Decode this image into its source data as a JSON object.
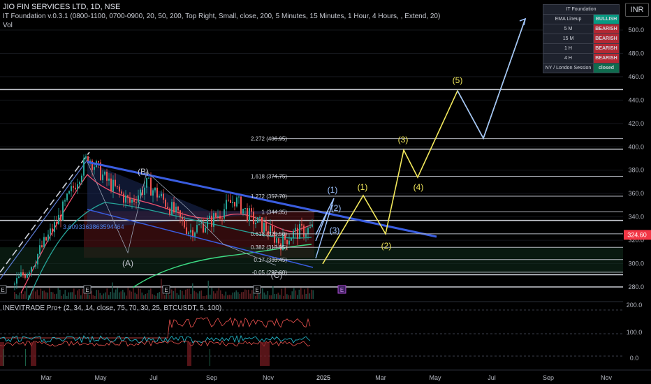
{
  "header": {
    "title": "JIO FIN SERVICES LTD, 1D, NSE",
    "indicator": "IT Foundation v.0.3.1 (0800-1100, 0700-0900, 20, 50, 200, Top Right, Small, close, 200, 5 Minutes, 15 Minutes, 1 Hour, 4 Hours, , Extend, 20)",
    "volume": "Vol",
    "currency": "INR"
  },
  "table": {
    "title": "IT Foundation",
    "rows": [
      {
        "label": "EMA Lineup",
        "value": "BULLISH",
        "color": "#089981"
      },
      {
        "label": "5 M",
        "value": "BEARISH",
        "color": "#b22833"
      },
      {
        "label": "15 M",
        "value": "BEARISH",
        "color": "#b22833"
      },
      {
        "label": "1 H",
        "value": "BEARISH",
        "color": "#b22833"
      },
      {
        "label": "4 H",
        "value": "BEARISH",
        "color": "#b22833"
      },
      {
        "label": "NY / London Session",
        "value": "closed",
        "color": "#0f6b4e"
      }
    ]
  },
  "oscillator": {
    "label": "INEVITRADE Pro+ (2, 34, 14, close, 75, 70, 30, 25, BTCUSDT, 5, 100)",
    "ticks": [
      "200.0",
      "100.0",
      "0.0"
    ]
  },
  "chart_data": {
    "type": "candlestick",
    "price_axis": {
      "min": 270,
      "max": 510,
      "ticks": [
        280,
        300,
        320,
        340,
        360,
        380,
        400,
        420,
        440,
        460,
        480,
        500
      ]
    },
    "time_axis": {
      "labels": [
        "Mar",
        "May",
        "Jul",
        "Sep",
        "Nov",
        "2025",
        "Mar",
        "May",
        "Jul",
        "Sep",
        "Nov"
      ]
    },
    "last_price": {
      "value": 324.6,
      "label": "324.60",
      "color": "#f23645"
    },
    "horizontal_levels": [
      449,
      398,
      337,
      290.5,
      280
    ],
    "fib_levels": [
      {
        "label": "2.272 (406.95)",
        "value": 406.95
      },
      {
        "label": "1.618 (374.75)",
        "value": 374.75
      },
      {
        "label": "1.272 (357.70)",
        "value": 357.7
      },
      {
        "label": "1 (344.35)",
        "value": 344.35
      },
      {
        "label": "0.618 (325.50)",
        "value": 325.5
      },
      {
        "label": "0.382 (313.95)",
        "value": 313.95
      },
      {
        "label": "0.17 (303.45)",
        "value": 303.45
      },
      {
        "label": "-0.05 (292.60)",
        "value": 292.6
      }
    ],
    "pattern_labels": [
      "(A)",
      "(B)",
      "(C)"
    ],
    "wave_labels_white": [
      "(1)",
      "(2)",
      "(3)"
    ],
    "wave_labels_yellow": [
      "(1)",
      "(2)",
      "(3)",
      "(4)",
      "(5)"
    ],
    "channel_value_label": "3.6093363863594464",
    "earnings_markers": [
      "E",
      "E",
      "E",
      "E",
      "E"
    ]
  }
}
